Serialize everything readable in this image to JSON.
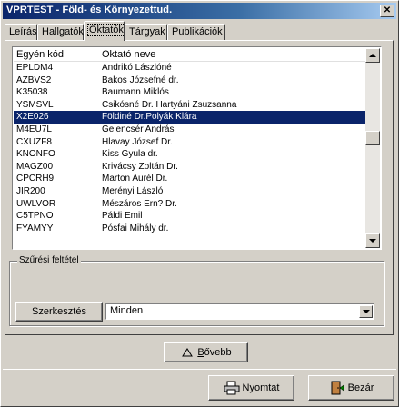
{
  "window": {
    "title": "VPRTEST - Föld- és Környezettud."
  },
  "tabs": [
    {
      "label": "Leírás"
    },
    {
      "label": "Hallgatók"
    },
    {
      "label": "Oktatók"
    },
    {
      "label": "Tárgyak"
    },
    {
      "label": "Publikációk"
    }
  ],
  "list": {
    "columns": [
      "Egyén kód",
      "Oktató neve"
    ],
    "rows": [
      [
        "EPLDM4",
        "Andrikó Lászlóné"
      ],
      [
        "AZBVS2",
        "Bakos Józsefné dr."
      ],
      [
        "K35038",
        "Baumann Miklós"
      ],
      [
        "YSMSVL",
        "Csikósné Dr. Hartyáni Zsuzsanna"
      ],
      [
        "X2E026",
        "Földiné Dr.Polyák Klára"
      ],
      [
        "M4EU7L",
        "Gelencsér András"
      ],
      [
        "CXUZF8",
        "Hlavay József Dr."
      ],
      [
        "KNONFO",
        "Kiss Gyula dr."
      ],
      [
        "MAGZ00",
        "Krivácsy Zoltán Dr."
      ],
      [
        "CPCRH9",
        "Marton Aurél Dr."
      ],
      [
        "JIR200",
        "Merényi László"
      ],
      [
        "UWLVOR",
        "Mészáros Ern? Dr."
      ],
      [
        "C5TPNO",
        "Páldi Emil"
      ],
      [
        "FYAMYY",
        "Pósfai Mihály dr."
      ]
    ],
    "selected_index": 4
  },
  "filter": {
    "group_label": "Szűrési feltétel",
    "edit_button": "Szerkesztés",
    "value": "Minden"
  },
  "buttons": {
    "more_prefix": "B",
    "more_rest": "ővebb",
    "print_prefix": "N",
    "print_rest": "yomtat",
    "close_prefix": "B",
    "close_rest": "ezár"
  },
  "colors": {
    "selection": "#0a246a",
    "face": "#d4d0c8",
    "titlebar": "#0a246a"
  },
  "icons": {
    "close": "close-icon",
    "more": "expand-icon",
    "print": "printer-icon",
    "exit": "door-exit-icon"
  }
}
